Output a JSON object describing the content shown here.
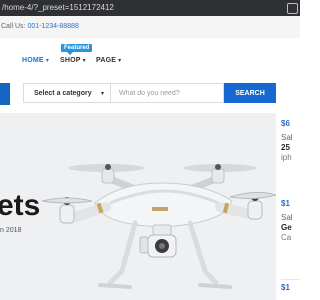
{
  "browser": {
    "url": "/home-4/?_preset=1512172412",
    "extension_icon": "puzzle-icon"
  },
  "topbar": {
    "call_label": "Call Us:",
    "call_number": "001-1234-88888"
  },
  "nav": {
    "items": [
      {
        "label": "HOME",
        "active": true,
        "icon": "chevron-down-icon"
      },
      {
        "label": "SHOP",
        "active": false,
        "icon": "chevron-down-icon"
      },
      {
        "label": "PAGE",
        "active": false,
        "icon": "chevron-down-icon"
      }
    ],
    "featured_badge": "Featured"
  },
  "search": {
    "category_label": "Select a category",
    "placeholder": "What do you need?",
    "button_label": "SEARCH"
  },
  "hero": {
    "title_fragment": "ets",
    "subtitle_fragment": "n 2018"
  },
  "sidebar": {
    "products": [
      {
        "price": "$6",
        "label": "Sal",
        "name": "25",
        "sub": "iph"
      },
      {
        "price": "$1",
        "label": "Sal",
        "name": "Ge",
        "sub": "Ca"
      },
      {
        "price": "$1"
      }
    ]
  },
  "colors": {
    "accent": "#1769d2",
    "link_blue": "#2b70c9",
    "badge": "#2796e0",
    "hero_bg": "#eff0f2"
  }
}
